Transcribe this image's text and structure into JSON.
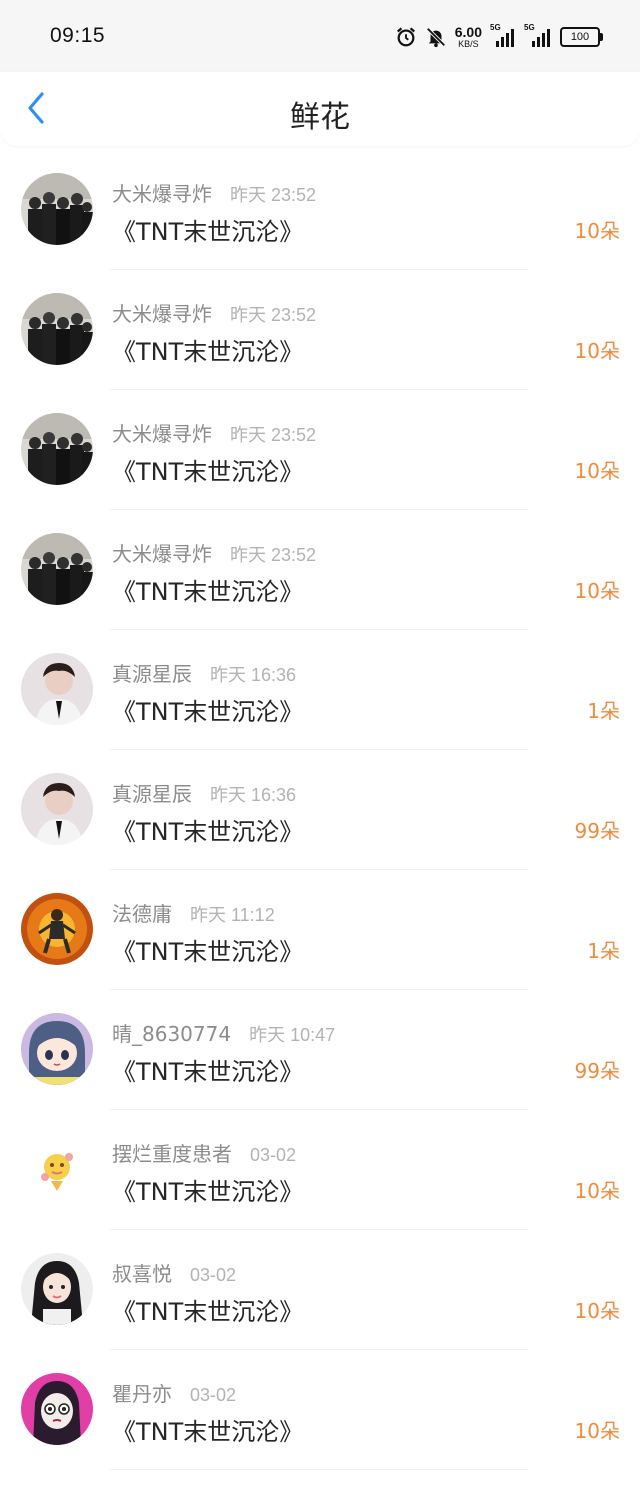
{
  "status_bar": {
    "time": "09:15",
    "net_speed": "6.00",
    "net_unit": "KB/S",
    "sim1_tag": "5G",
    "sim2_tag": "5G",
    "battery": "100",
    "icons": [
      "alarm-icon",
      "mute-icon"
    ]
  },
  "nav": {
    "title": "鲜花",
    "back_icon": "chevron-left-icon",
    "accent_color": "#2e8ef7"
  },
  "colors": {
    "count": "#f08a3c",
    "username": "#8c8c8c",
    "time": "#b3b3b3"
  },
  "items": [
    {
      "username": "大米爆寻炸",
      "time": "昨天 23:52",
      "title": "《TNT末世沉沦》",
      "count": "10朵",
      "avatar": "group-photo"
    },
    {
      "username": "大米爆寻炸",
      "time": "昨天 23:52",
      "title": "《TNT末世沉沦》",
      "count": "10朵",
      "avatar": "group-photo"
    },
    {
      "username": "大米爆寻炸",
      "time": "昨天 23:52",
      "title": "《TNT末世沉沦》",
      "count": "10朵",
      "avatar": "group-photo"
    },
    {
      "username": "大米爆寻炸",
      "time": "昨天 23:52",
      "title": "《TNT末世沉沦》",
      "count": "10朵",
      "avatar": "group-photo"
    },
    {
      "username": "真源星辰",
      "time": "昨天 16:36",
      "title": "《TNT末世沉沦》",
      "count": "1朵",
      "avatar": "portrait-photo"
    },
    {
      "username": "真源星辰",
      "time": "昨天 16:36",
      "title": "《TNT末世沉沦》",
      "count": "99朵",
      "avatar": "portrait-photo"
    },
    {
      "username": "法德庸",
      "time": "昨天 11:12",
      "title": "《TNT末世沉沦》",
      "count": "1朵",
      "avatar": "figure-fire"
    },
    {
      "username": "晴_8630774",
      "time": "昨天 10:47",
      "title": "《TNT末世沉沦》",
      "count": "99朵",
      "avatar": "anime-girl"
    },
    {
      "username": "摆烂重度患者",
      "time": "03-02",
      "title": "《TNT末世沉沦》",
      "count": "10朵",
      "avatar": "cartoon-sticker"
    },
    {
      "username": "叔喜悦",
      "time": "03-02",
      "title": "《TNT末世沉沦》",
      "count": "10朵",
      "avatar": "girl-photo"
    },
    {
      "username": "瞿丹亦",
      "time": "03-02",
      "title": "《TNT末世沉沦》",
      "count": "10朵",
      "avatar": "cartoon-face"
    }
  ]
}
